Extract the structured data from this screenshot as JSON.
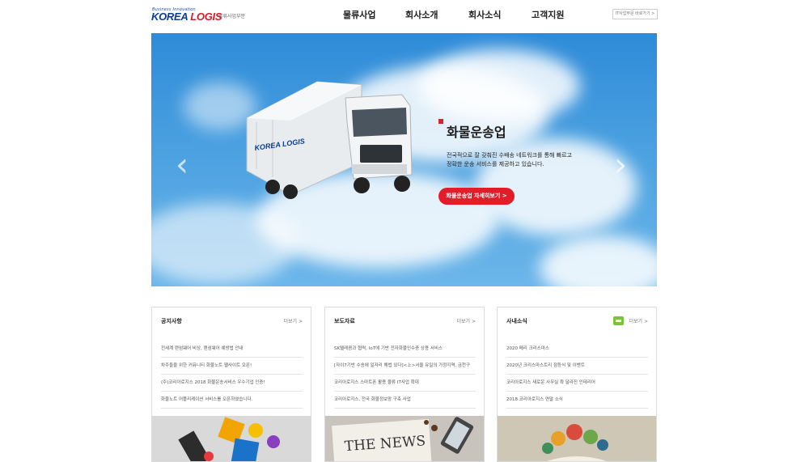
{
  "header": {
    "logo_small": "Business Innovation",
    "logo_main_left": "KOREA",
    "logo_main_right": "LOGIS",
    "logo_sub": "물류사업부문",
    "nav": [
      "물류사업",
      "회사소개",
      "회사소식",
      "고객지원"
    ],
    "it_button": "IT사업부문 바로가기 >"
  },
  "banner": {
    "prev_arrow": "‹",
    "next_arrow": "›",
    "title": "화물운송업",
    "desc_line1": "전국적으로 잘 갖춰진 수배송 네트워크를 통해 빠르고",
    "desc_line2": "정확한 운송 서비스를 제공하고 있습니다.",
    "button": "화물운송업 자세히보기 >",
    "truck_logo": "KOREA LOGIS"
  },
  "cards": [
    {
      "title": "공지사항",
      "more": "더보기 >",
      "items": [
        "전세계 랜섬웨어 비상, 랜섬웨어 예방법 안내",
        "차주들을 위한 커뮤니티 화물노트 웹사이트 오픈!",
        "(주)코리아로지스 2018 화물운송서비스 우수기업 인증!",
        "화물노트 어플리케이션 서비스를 오픈하였습니다."
      ],
      "image_text": ""
    },
    {
      "title": "보도자료",
      "more": "더보기 >",
      "items": [
        "SK텔레콤과 협력, IoT에 기반 전자화물인수증 상용 서비스",
        "[자이7기반 수송에 일자리 해법 있다]<上>서울 유일의 가정지역, 금천구",
        "코리아로지스 스마트폰 활용 물류 IT사업 확대",
        "코리아로지스, 전국 화물정보망 구축 사업"
      ],
      "image_text": "THE NEWS"
    },
    {
      "title": "사내소식",
      "more": "더보기 >",
      "items": [
        "2020 메리 크리스마스",
        "2020년 크리스마스트리 점등식 및 이벤트",
        "코리아로지스 새로운 사무실 확 달라진 인테리어",
        "2018 코리아로지스 연말 소식"
      ],
      "image_text": ""
    }
  ],
  "colors": {
    "accent_red": "#e11d2a",
    "brand_blue": "#0b3d91",
    "sky_blue": "#3a93dc"
  }
}
